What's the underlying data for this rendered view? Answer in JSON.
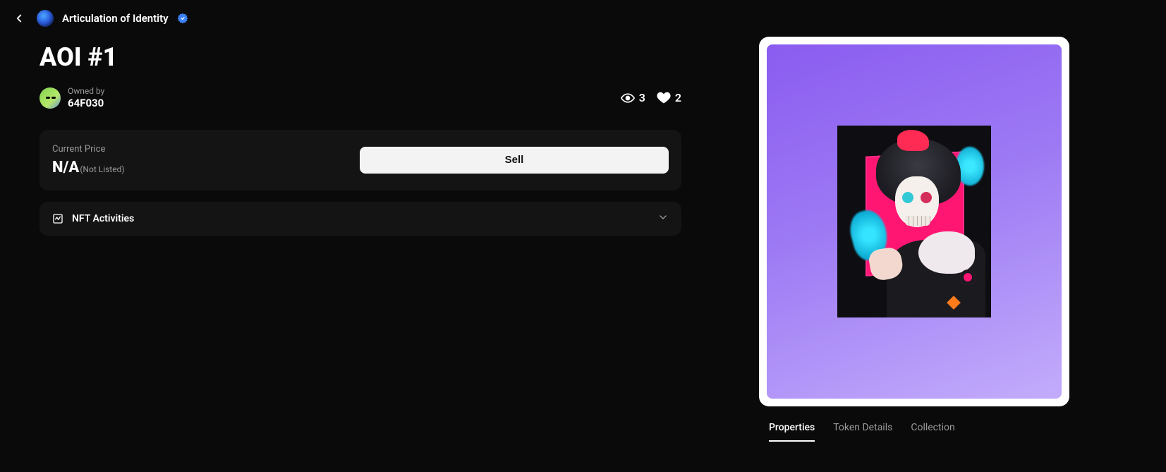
{
  "header": {
    "collection_name": "Articulation of Identity"
  },
  "nft": {
    "title": "AOI #1",
    "owned_by_label": "Owned by",
    "owner_address": "64F030"
  },
  "stats": {
    "views": "3",
    "likes": "2"
  },
  "price_card": {
    "label": "Current Price",
    "value": "N/A",
    "note": "(Not Listed)",
    "sell_button": "Sell"
  },
  "activities": {
    "title": "NFT Activities"
  },
  "tabs": [
    {
      "label": "Properties",
      "active": true
    },
    {
      "label": "Token Details",
      "active": false
    },
    {
      "label": "Collection",
      "active": false
    }
  ]
}
